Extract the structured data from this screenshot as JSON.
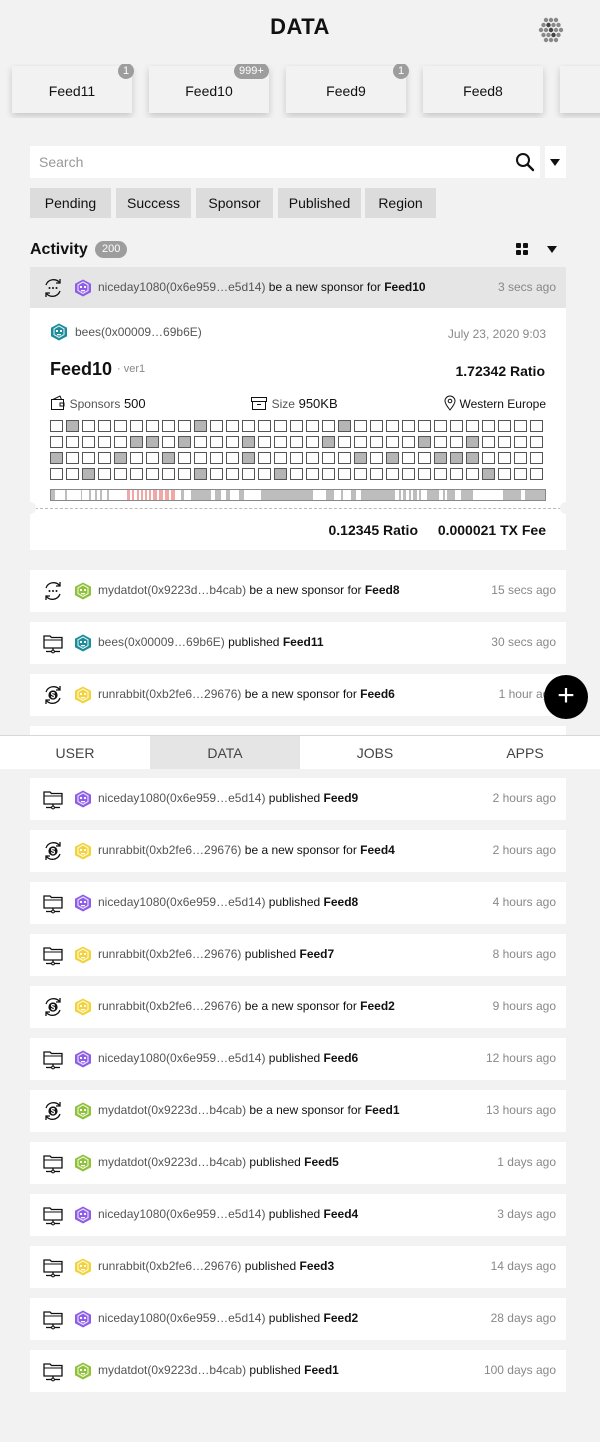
{
  "header": {
    "title": "DATA",
    "logo_icon": "hex-dots-logo-icon"
  },
  "feeds": [
    {
      "label": "Feed11",
      "badge": "1"
    },
    {
      "label": "Feed10",
      "badge": "999+"
    },
    {
      "label": "Feed9",
      "badge": "1"
    },
    {
      "label": "Feed8",
      "badge": ""
    },
    {
      "label": "",
      "badge": ""
    }
  ],
  "search": {
    "placeholder": "Search",
    "value": ""
  },
  "filters": [
    "Pending",
    "Success",
    "Sponsor",
    "Published",
    "Region"
  ],
  "activity": {
    "label": "Activity",
    "count": "200"
  },
  "selected": {
    "user": "niceday1080(0x6e959…e5d14)",
    "action": " be a new sponsor for ",
    "feed": "Feed10",
    "time": "3 secs ago",
    "avatar_color": "#8e5ee8",
    "icon": "sponsor-cycle-icon"
  },
  "detail": {
    "user": "bees(0x00009…69b6E)",
    "date": "July 23, 2020 9:03",
    "feed": "Feed10",
    "version": "· ver1",
    "ratio": "1.72342 Ratio",
    "sponsors_label": "Sponsors",
    "sponsors_value": "500",
    "size_label": "Size",
    "size_value": "950KB",
    "region": "Western Europe",
    "ratio2": "0.12345 Ratio",
    "fee": "0.000021 TX Fee",
    "avatar_color": "#1a8c9a"
  },
  "rows_top": [
    {
      "user": "mydatdot(0x9223d…b4cab)",
      "action": " be a new sponsor for ",
      "feed": "Feed8",
      "time": "15 secs ago",
      "icon": "sponsor-cycle-icon",
      "avatar_color": "#8fc23a"
    },
    {
      "user": "bees(0x00009…69b6E)",
      "action": " published ",
      "feed": "Feed11",
      "time": "30 secs ago",
      "icon": "publish-monitor-icon",
      "avatar_color": "#1a8c9a"
    },
    {
      "user": "runrabbit(0xb2fe6…29676)",
      "action": " be a new sponsor for ",
      "feed": "Feed6",
      "time": "1 hour ago",
      "icon": "dollar-cycle-icon",
      "avatar_color": "#f2d33c"
    }
  ],
  "tabs": [
    "USER",
    "DATA",
    "JOBS",
    "APPS"
  ],
  "active_tab": "DATA",
  "rows_bottom": [
    {
      "user": "niceday1080(0x6e959…e5d14)",
      "action": " published ",
      "feed": "Feed9",
      "time": "2 hours ago",
      "icon": "publish-monitor-icon",
      "avatar_color": "#8e5ee8"
    },
    {
      "user": "runrabbit(0xb2fe6…29676)",
      "action": " be a new sponsor for ",
      "feed": "Feed4",
      "time": "2 hours ago",
      "icon": "dollar-cycle-icon",
      "avatar_color": "#f2d33c"
    },
    {
      "user": "niceday1080(0x6e959…e5d14)",
      "action": " published ",
      "feed": "Feed8",
      "time": "4 hours ago",
      "icon": "publish-monitor-icon",
      "avatar_color": "#8e5ee8"
    },
    {
      "user": "runrabbit(0xb2fe6…29676)",
      "action": " published ",
      "feed": "Feed7",
      "time": "8 hours ago",
      "icon": "publish-monitor-icon",
      "avatar_color": "#f2d33c"
    },
    {
      "user": "runrabbit(0xb2fe6…29676)",
      "action": " be a new sponsor for ",
      "feed": "Feed2",
      "time": "9 hours ago",
      "icon": "dollar-cycle-icon",
      "avatar_color": "#f2d33c"
    },
    {
      "user": "niceday1080(0x6e959…e5d14)",
      "action": " published ",
      "feed": "Feed6",
      "time": "12 hours ago",
      "icon": "publish-monitor-icon",
      "avatar_color": "#8e5ee8"
    },
    {
      "user": "mydatdot(0x9223d…b4cab)",
      "action": " be a new sponsor for ",
      "feed": "Feed1",
      "time": "13 hours ago",
      "icon": "dollar-cycle-icon",
      "avatar_color": "#8fc23a"
    },
    {
      "user": "mydatdot(0x9223d…b4cab)",
      "action": " published ",
      "feed": "Feed5",
      "time": "1 days ago",
      "icon": "publish-monitor-icon",
      "avatar_color": "#8fc23a"
    },
    {
      "user": "niceday1080(0x6e959…e5d14)",
      "action": " published ",
      "feed": "Feed4",
      "time": "3 days ago",
      "icon": "publish-monitor-icon",
      "avatar_color": "#8e5ee8"
    },
    {
      "user": "runrabbit(0xb2fe6…29676)",
      "action": " published ",
      "feed": "Feed3",
      "time": "14 days ago",
      "icon": "publish-monitor-icon",
      "avatar_color": "#f2d33c"
    },
    {
      "user": "niceday1080(0x6e959…e5d14)",
      "action": " published ",
      "feed": "Feed2",
      "time": "28 days ago",
      "icon": "publish-monitor-icon",
      "avatar_color": "#8e5ee8"
    },
    {
      "user": "mydatdot(0x9223d…b4cab)",
      "action": " published ",
      "feed": "Feed1",
      "time": "100 days ago",
      "icon": "publish-monitor-icon",
      "avatar_color": "#8fc23a"
    }
  ],
  "add_button": {
    "label": "+"
  }
}
